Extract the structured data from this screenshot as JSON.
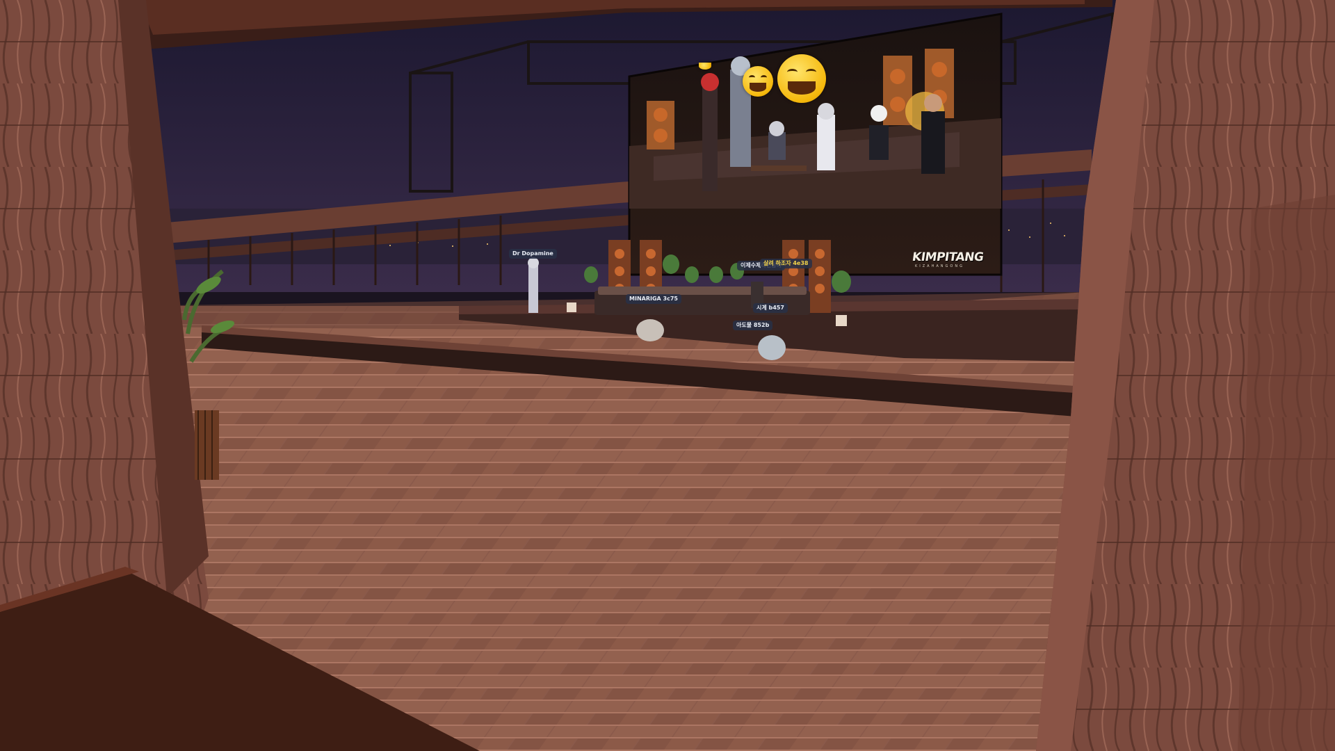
{
  "scene": {
    "description_tag": "virtual-world-rooftop-venue",
    "screen_logo": "KIMPITANG",
    "screen_logo_sub": "KIZAHANGONG"
  },
  "nametags": [
    {
      "text": "Dr Dopamine"
    },
    {
      "text": "이제수제라면담아"
    },
    {
      "text": "살려 하조자 4e38"
    },
    {
      "text": "MINARIGA 3c75"
    },
    {
      "text": "시계 b457"
    },
    {
      "text": "아도물 852b"
    }
  ],
  "colors": {
    "floor": "#8a5a4a",
    "night_sky": "#2a2240",
    "wood_pillar": "#7a4a3e",
    "nametag_bg": "#283046"
  }
}
